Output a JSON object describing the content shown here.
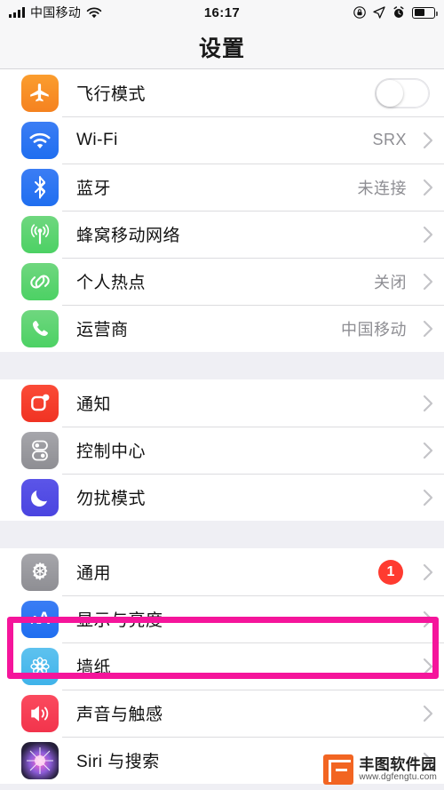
{
  "status_bar": {
    "carrier": "中国移动",
    "time": "16:17",
    "icons": [
      "signal-bars-icon",
      "wifi-icon",
      "rotation-lock-icon",
      "location-arrow-icon",
      "alarm-clock-icon",
      "battery-icon"
    ],
    "battery_level": "55"
  },
  "nav": {
    "title": "设置"
  },
  "groups": [
    {
      "rows": [
        {
          "label": "飞行模式",
          "value": "",
          "icon": "airplane-icon",
          "icon_color": "#f58220",
          "accessory": "toggle",
          "toggle_on": false
        },
        {
          "label": "Wi-Fi",
          "value": "SRX",
          "icon": "wifi-icon",
          "icon_color": "#1f6ef0",
          "accessory": "chevron"
        },
        {
          "label": "蓝牙",
          "value": "未连接",
          "icon": "bluetooth-icon",
          "icon_color": "#1f6ef0",
          "accessory": "chevron"
        },
        {
          "label": "蜂窝移动网络",
          "value": "",
          "icon": "cellular-antenna-icon",
          "icon_color": "#4cd164",
          "accessory": "chevron"
        },
        {
          "label": "个人热点",
          "value": "关闭",
          "icon": "hotspot-link-icon",
          "icon_color": "#4cd164",
          "accessory": "chevron"
        },
        {
          "label": "运营商",
          "value": "中国移动",
          "icon": "phone-icon",
          "icon_color": "#4cd164",
          "accessory": "chevron"
        }
      ]
    },
    {
      "rows": [
        {
          "label": "通知",
          "value": "",
          "icon": "notification-icon",
          "icon_color": "#f03323",
          "accessory": "chevron"
        },
        {
          "label": "控制中心",
          "value": "",
          "icon": "control-center-icon",
          "icon_color": "#8e8e93",
          "accessory": "chevron"
        },
        {
          "label": "勿扰模式",
          "value": "",
          "icon": "moon-icon",
          "icon_color": "#4a44e0",
          "accessory": "chevron"
        }
      ]
    },
    {
      "rows": [
        {
          "label": "通用",
          "value": "",
          "icon": "gear-icon",
          "icon_color": "#8e8e93",
          "accessory": "badge",
          "badge": "1"
        },
        {
          "label": "显示与亮度",
          "value": "",
          "icon": "display-brightness-aa-icon",
          "icon_color": "#1f6ef0",
          "accessory": "chevron",
          "highlighted": true
        },
        {
          "label": "墙纸",
          "value": "",
          "icon": "wallpaper-flower-icon",
          "icon_color": "#3fb3ea",
          "accessory": "chevron"
        },
        {
          "label": "声音与触感",
          "value": "",
          "icon": "sound-haptics-speaker-icon",
          "icon_color": "#f2344c",
          "accessory": "chevron"
        },
        {
          "label": "Siri 与搜索",
          "value": "",
          "icon": "siri-icon",
          "icon_color": "#2b2344",
          "accessory": "chevron"
        }
      ]
    }
  ],
  "annotation": {
    "highlight_color": "#f5159b",
    "target": "显示与亮度"
  },
  "watermark": {
    "name": "丰图软件园",
    "url": "www.dgfengtu.com"
  }
}
